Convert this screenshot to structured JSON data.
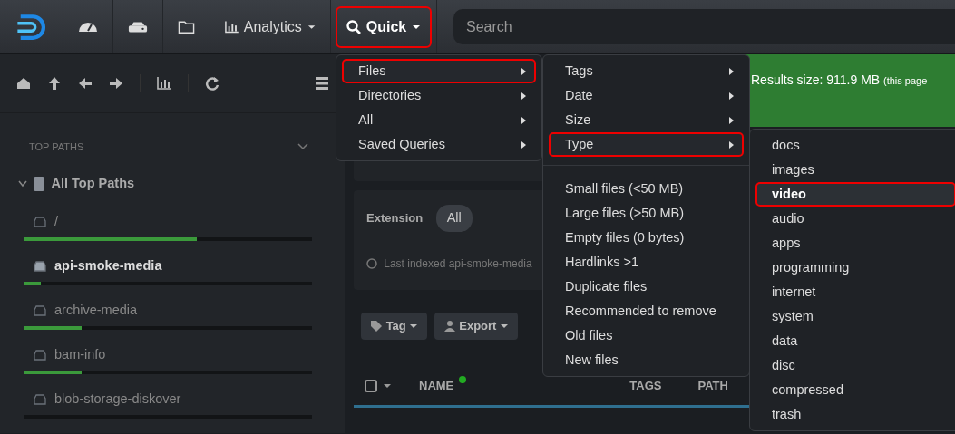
{
  "navbar": {
    "items": [
      {
        "kind": "icon",
        "selected": false
      },
      {
        "kind": "icon",
        "selected": false
      },
      {
        "kind": "icon",
        "selected": false
      },
      {
        "kind": "dropdown",
        "label": "Analytics",
        "selected": false
      },
      {
        "kind": "dropdown",
        "label": "Quick",
        "selected": true
      }
    ],
    "search": {
      "placeholder": "Search"
    }
  },
  "sidebar": {
    "section": "TOP PATHS",
    "root": {
      "label": "All Top Paths",
      "expanded": true,
      "children": [
        {
          "label": "/",
          "level": 0.6,
          "selected": false
        },
        {
          "label": "api-smoke-media",
          "level": 0.06,
          "selected": true
        },
        {
          "label": "archive-media",
          "level": 0.2,
          "selected": false
        },
        {
          "label": "bam-info",
          "level": 0.2,
          "selected": false
        },
        {
          "label": "blob-storage-diskover",
          "level": 0,
          "selected": false
        }
      ]
    }
  },
  "main": {
    "banner": {
      "text": "Results size: 911.9 MB",
      "note": "(this page"
    },
    "filter": {
      "label": "Extension",
      "value": "All"
    },
    "info": "Last indexed api-smoke-media",
    "actions": [
      "Tag",
      "Export"
    ],
    "table": {
      "select_all_checked": false,
      "columns": [
        "NAME",
        "TAGS",
        "PATH"
      ]
    }
  },
  "quick_menu": {
    "items": [
      {
        "label": "Files",
        "kind": "submenu",
        "selected": true
      },
      {
        "label": "Directories",
        "kind": "submenu",
        "selected": false
      },
      {
        "label": "All",
        "kind": "submenu",
        "selected": false
      },
      {
        "label": "Saved Queries",
        "kind": "submenu",
        "selected": false
      }
    ]
  },
  "files_menu": {
    "items": [
      {
        "label": "Tags",
        "kind": "submenu",
        "selected": false
      },
      {
        "label": "Date",
        "kind": "submenu",
        "selected": false
      },
      {
        "label": "Size",
        "kind": "submenu",
        "selected": false
      },
      {
        "label": "Type",
        "kind": "submenu",
        "selected": true
      },
      {
        "kind": "divider"
      },
      {
        "label": "Small files (<50 MB)",
        "kind": "item",
        "selected": false
      },
      {
        "label": "Large files (>50 MB)",
        "kind": "item",
        "selected": false
      },
      {
        "label": "Empty files (0 bytes)",
        "kind": "item",
        "selected": false
      },
      {
        "label": "Hardlinks >1",
        "kind": "item",
        "selected": false
      },
      {
        "label": "Duplicate files",
        "kind": "item",
        "selected": false
      },
      {
        "label": "Recommended to remove",
        "kind": "item",
        "selected": false
      },
      {
        "label": "Old files",
        "kind": "item",
        "selected": false
      },
      {
        "label": "New files",
        "kind": "item",
        "selected": false
      }
    ]
  },
  "type_menu": {
    "items": [
      {
        "label": "docs",
        "kind": "item",
        "selected": false
      },
      {
        "label": "images",
        "kind": "item",
        "selected": false
      },
      {
        "label": "video",
        "kind": "item",
        "selected": true
      },
      {
        "label": "audio",
        "kind": "item",
        "selected": false
      },
      {
        "label": "apps",
        "kind": "item",
        "selected": false
      },
      {
        "label": "programming",
        "kind": "item",
        "selected": false
      },
      {
        "label": "internet",
        "kind": "item",
        "selected": false
      },
      {
        "label": "system",
        "kind": "item",
        "selected": false
      },
      {
        "label": "data",
        "kind": "item",
        "selected": false
      },
      {
        "label": "disc",
        "kind": "item",
        "selected": false
      },
      {
        "label": "compressed",
        "kind": "item",
        "selected": false
      },
      {
        "label": "trash",
        "kind": "item",
        "selected": false
      }
    ]
  }
}
